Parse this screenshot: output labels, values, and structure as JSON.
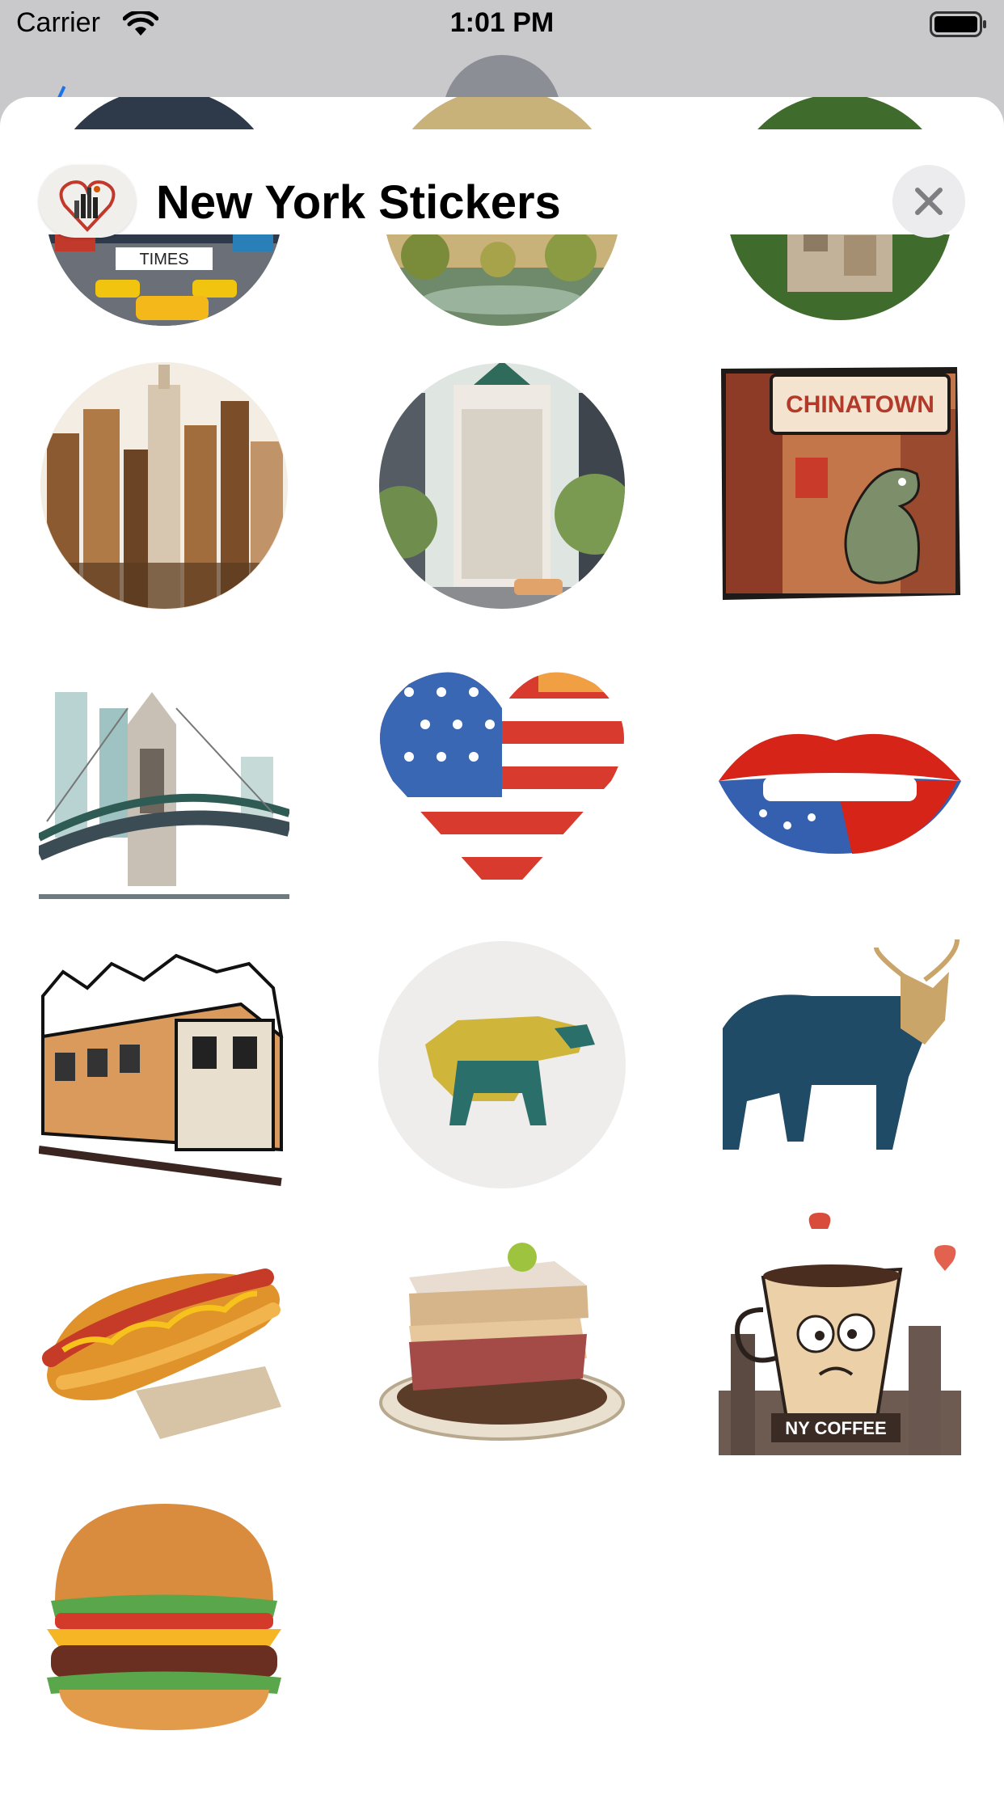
{
  "status_bar": {
    "carrier": "Carrier",
    "time": "1:01 PM"
  },
  "sheet": {
    "title": "New York Stickers",
    "close_icon": "close-x-icon"
  },
  "stickers": [
    {
      "name": "times-square",
      "label": "TIMES"
    },
    {
      "name": "central-park",
      "label": ""
    },
    {
      "name": "aerial-city",
      "label": ""
    },
    {
      "name": "empire-state-skyline",
      "label": ""
    },
    {
      "name": "flatiron-building",
      "label": ""
    },
    {
      "name": "chinatown-dragon",
      "label": "CHINATOWN"
    },
    {
      "name": "brooklyn-bridge",
      "label": ""
    },
    {
      "name": "usa-flag-heart",
      "label": ""
    },
    {
      "name": "usa-flag-lips",
      "label": ""
    },
    {
      "name": "subway-train",
      "label": ""
    },
    {
      "name": "geometric-bull",
      "label": ""
    },
    {
      "name": "wall-street-bull",
      "label": ""
    },
    {
      "name": "hot-dog",
      "label": ""
    },
    {
      "name": "pastrami-sandwich",
      "label": ""
    },
    {
      "name": "ny-coffee-cup",
      "label": "NY COFFEE"
    },
    {
      "name": "cheeseburger",
      "label": ""
    }
  ]
}
